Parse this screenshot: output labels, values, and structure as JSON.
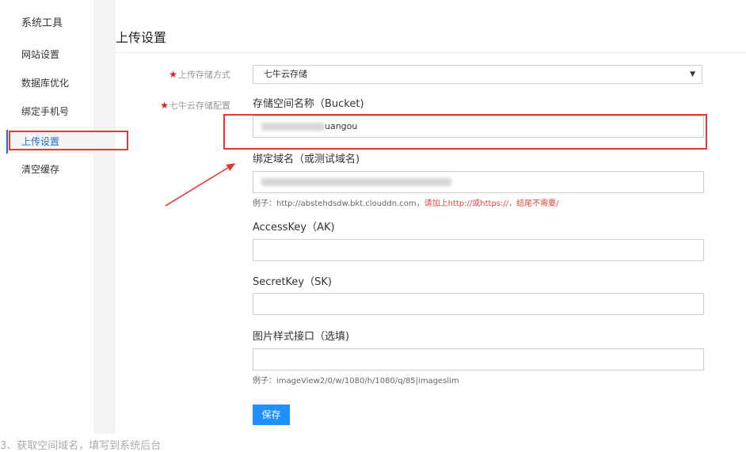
{
  "sidebar": {
    "title": "系统工具",
    "items": [
      {
        "label": "网站设置",
        "active": false
      },
      {
        "label": "数据库优化",
        "active": false
      },
      {
        "label": "绑定手机号",
        "active": false
      },
      {
        "label": "上传设置",
        "active": true
      },
      {
        "label": "清空缓存",
        "active": false
      }
    ]
  },
  "main": {
    "title": "上传设置",
    "required_mark": "★",
    "storage_method": {
      "label": "上传存储方式",
      "selected": "七牛云存储"
    },
    "storage_config_label": "七牛云存储配置",
    "bucket": {
      "label": "存储空间名称（Bucket)",
      "value_visible": "uangou"
    },
    "domain": {
      "label": "绑定域名（或测试域名)",
      "hint_prefix": "例子：http://abstehdsdw.bkt.clouddn.com，",
      "hint_red": "请加上http://或https://，结尾不需要/"
    },
    "access_key": {
      "label": "AccessKey（AK)",
      "value": ""
    },
    "secret_key": {
      "label": "SecretKey（SK)",
      "value": ""
    },
    "image_style": {
      "label": "图片样式接口（选填)",
      "value": "",
      "hint": "例子：imageView2/0/w/1080/h/1080/q/85|imageslim"
    },
    "save_label": "保存"
  },
  "annotations": {
    "highlight_color": "#e53935",
    "accent_color": "#1e90ff"
  },
  "bottom_text": "3、获取空间域名，填写到系统后台"
}
